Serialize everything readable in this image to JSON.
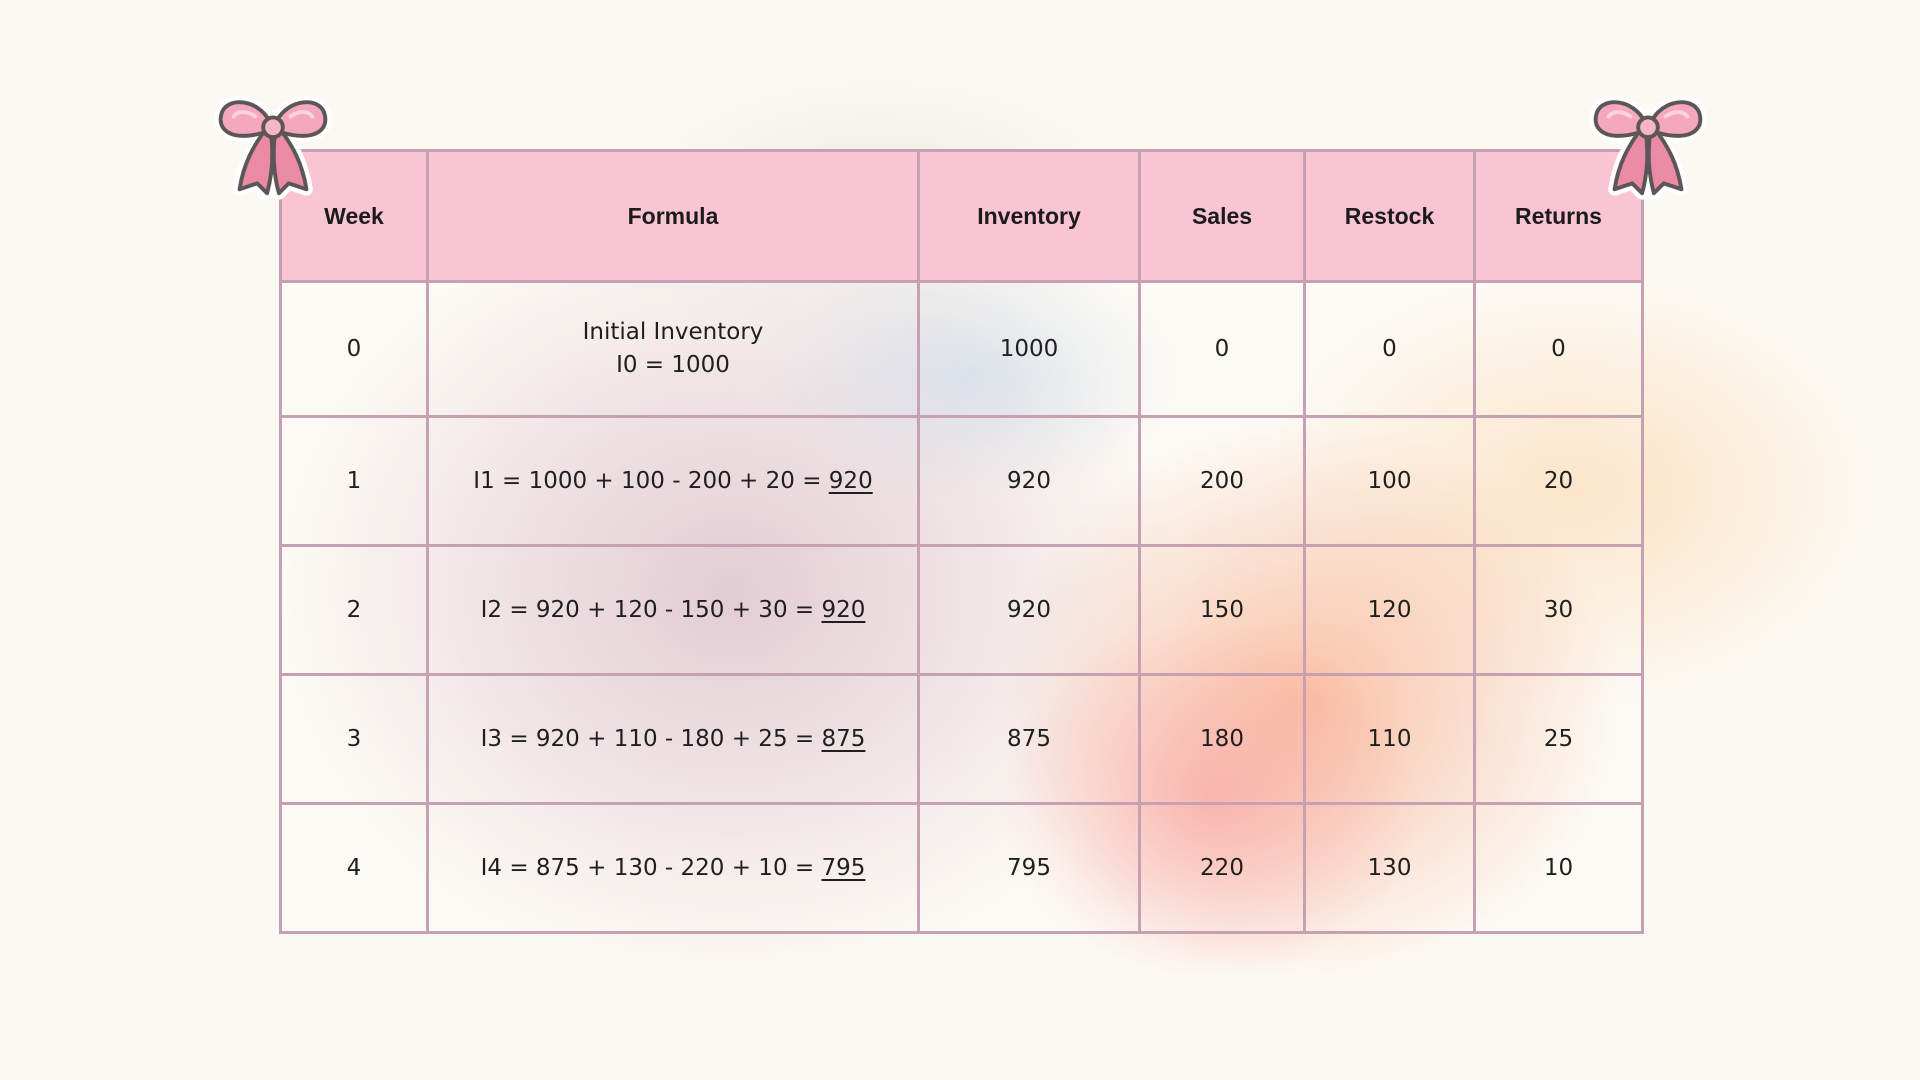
{
  "table": {
    "headers": [
      "Week",
      "Formula",
      "Inventory",
      "Sales",
      "Restock",
      "Returns"
    ],
    "rows": [
      {
        "week": "0",
        "formula_line1": "Initial Inventory",
        "formula_line2": "I0 = 1000",
        "inventory": "1000",
        "sales": "0",
        "restock": "0",
        "returns": "0"
      },
      {
        "week": "1",
        "formula": "I1 = 1000 + 100 - 200 + 20 = ",
        "result": "920",
        "inventory": "920",
        "sales": "200",
        "restock": "100",
        "returns": "20"
      },
      {
        "week": "2",
        "formula": "I2 = 920 + 120 - 150 + 30 = ",
        "result": "920",
        "inventory": "920",
        "sales": "150",
        "restock": "120",
        "returns": "30"
      },
      {
        "week": "3",
        "formula": "I3 = 920 + 110 - 180 + 25 = ",
        "result": "875",
        "inventory": "875",
        "sales": "180",
        "restock": "110",
        "returns": "25"
      },
      {
        "week": "4",
        "formula": "I4 = 875 + 130 - 220 + 10 = ",
        "result": "795",
        "inventory": "795",
        "sales": "220",
        "restock": "130",
        "returns": "10"
      }
    ]
  },
  "colors": {
    "header_fill": "#f9c5d2",
    "grid_line": "#c6a1b4",
    "background": "#fcf9f3",
    "bow_pink": "#f4a7bd",
    "bow_dark_pink": "#ea8aa5",
    "bow_outline": "#5d5658"
  },
  "decorations": {
    "bow_left_icon": "pink-bow-icon",
    "bow_right_icon": "pink-bow-icon"
  }
}
